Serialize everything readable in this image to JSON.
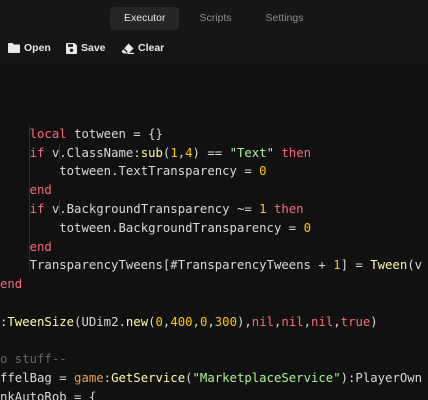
{
  "tabs": [
    "Executor",
    "Scripts",
    "Settings"
  ],
  "toolbar": {
    "open": "Open",
    "save": "Save",
    "clear": "Clear"
  },
  "code_lines": [
    "",
    "    local totween = {}",
    "    if v.ClassName:sub(1,4) == \"Text\" then",
    "        totween.TextTransparency = 0",
    "    end",
    "    if v.BackgroundTransparency ~= 1 then",
    "        totween.BackgroundTransparency = 0",
    "    end",
    "    TransparencyTweens[#TransparencyTweens + 1] = Tween(v",
    "end",
    "",
    ":TweenSize(UDim2.new(0,400,0,300),nil,nil,nil,true)",
    "",
    "o stuff--",
    "ffelBag = game:GetService(\"MarketplaceService\"):PlayerOwn",
    "nkAutoRob = {"
  ]
}
